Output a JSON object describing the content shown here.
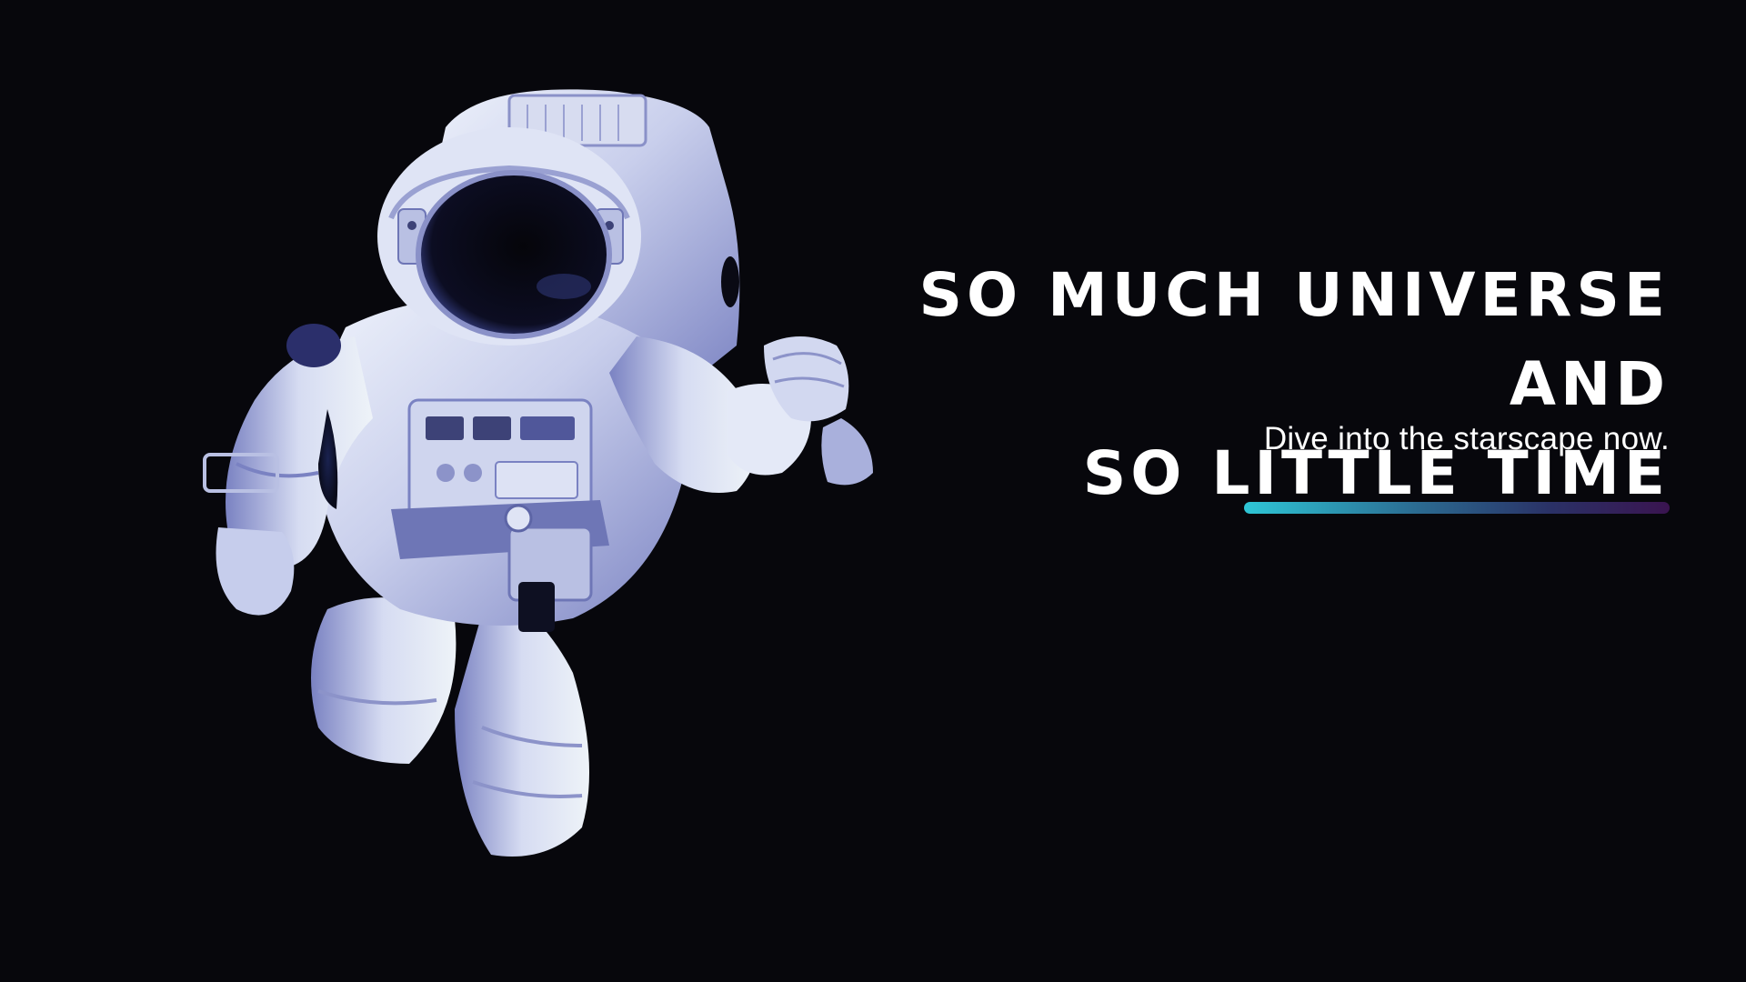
{
  "hero": {
    "title_line_1": "SO MUCH UNIVERSE AND",
    "title_line_2": "SO LITTLE TIME",
    "subtitle": "Dive into the starscape now."
  },
  "image": {
    "subject": "astronaut-floating-in-space"
  },
  "colors": {
    "background": "#07070c",
    "text": "#ffffff",
    "accent_start": "#2ec6d6",
    "accent_end": "#3a1450",
    "suit_light": "#dfe6f3",
    "suit_shadow": "#6d74b8"
  }
}
